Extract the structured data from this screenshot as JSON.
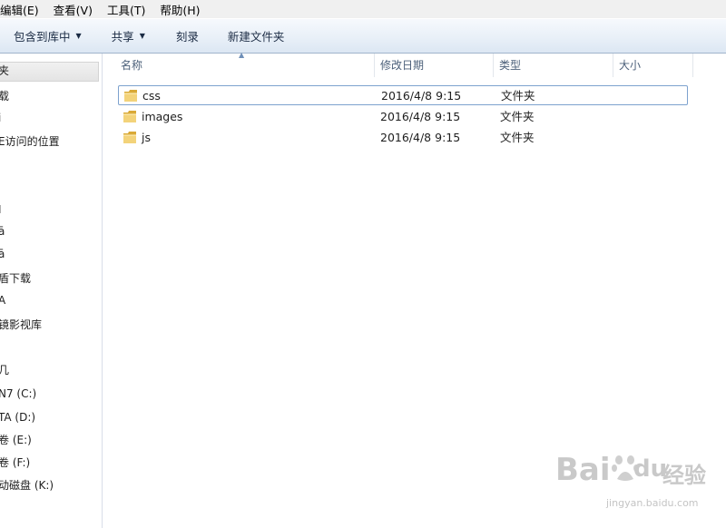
{
  "menubar": {
    "items": [
      "编辑(E)",
      "查看(V)",
      "工具(T)",
      "帮助(H)"
    ]
  },
  "toolbar": {
    "include_in_library": "包含到库中",
    "share": "共享",
    "burn": "刻录",
    "new_folder": "新建文件夹"
  },
  "nav": {
    "items": [
      "夹",
      "载",
      "i",
      "E访问的位置",
      "",
      "I",
      "ā",
      "",
      "盾下载",
      "A",
      "镜影视库",
      "几",
      "N7 (C:)",
      "TA (D:)",
      "卷 (E:)",
      "卷 (F:)",
      "动磁盘 (K:)"
    ]
  },
  "columns": {
    "name": "名称",
    "modified": "修改日期",
    "type": "类型",
    "size": "大小"
  },
  "files": [
    {
      "name": "css",
      "modified": "2016/4/8 9:15",
      "type": "文件夹",
      "size": "",
      "icon": "folder-icon"
    },
    {
      "name": "images",
      "modified": "2016/4/8 9:15",
      "type": "文件夹",
      "size": "",
      "icon": "folder-icon"
    },
    {
      "name": "js",
      "modified": "2016/4/8 9:15",
      "type": "文件夹",
      "size": "",
      "icon": "folder-icon"
    }
  ],
  "watermark": {
    "brand": "Bai",
    "brand_tail": "du",
    "product": "经验",
    "url": "jingyan.baidu.com"
  },
  "colors": {
    "toolbar_bg": "#e9f0f8",
    "selection_border": "#7da2ce",
    "header_text": "#4c607a",
    "folder": "#e8c15a"
  }
}
